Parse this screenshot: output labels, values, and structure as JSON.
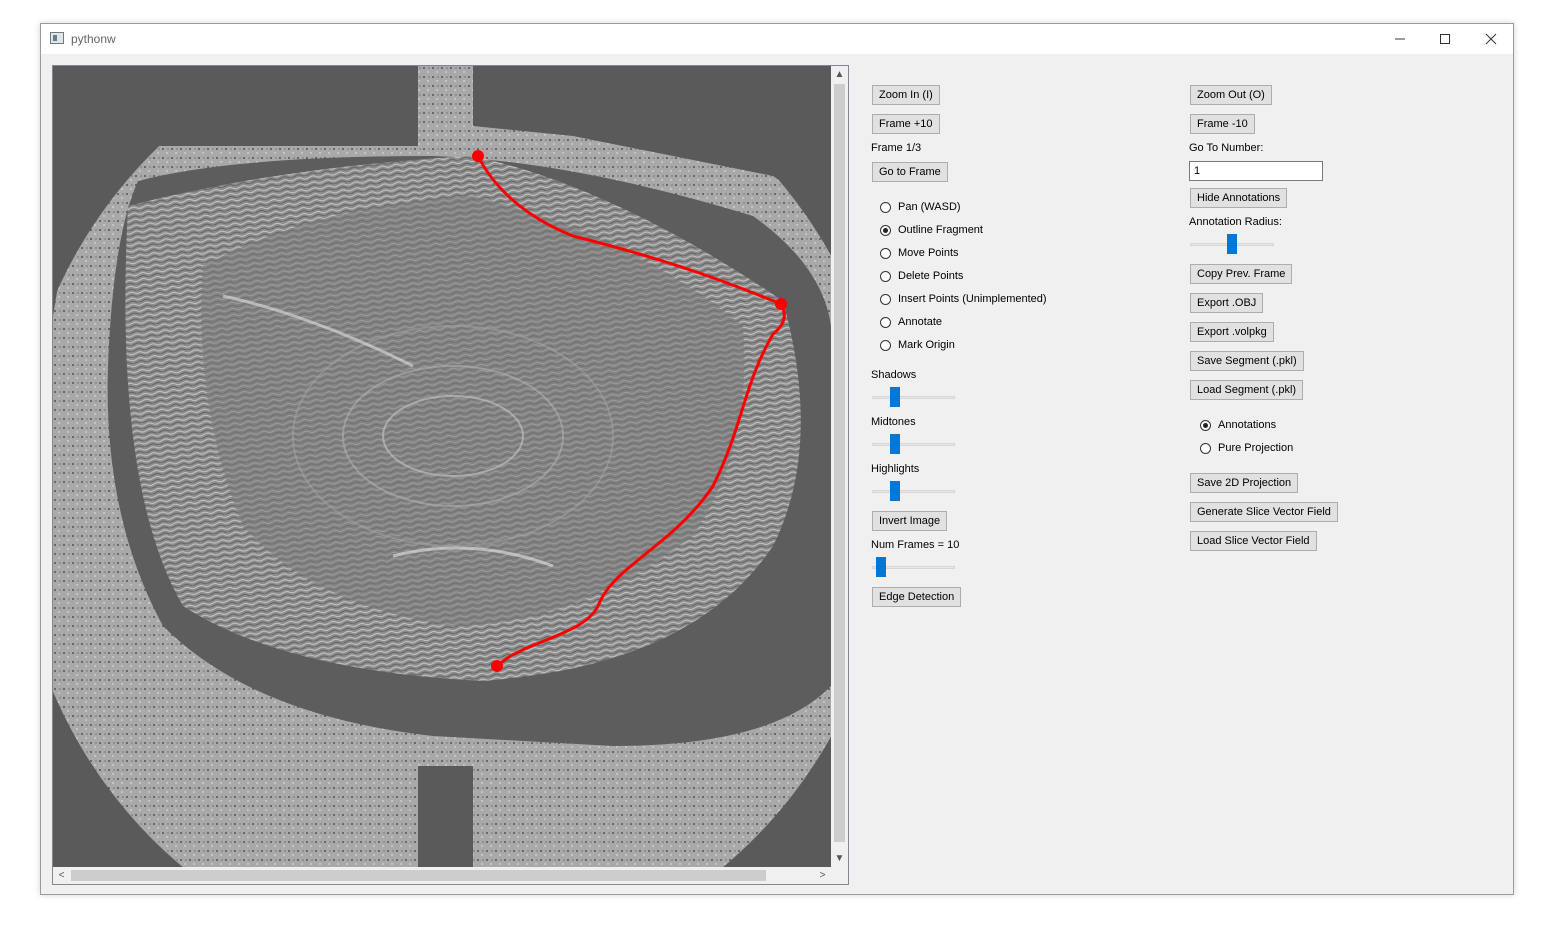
{
  "window": {
    "title": "pythonw"
  },
  "viewer": {
    "scroll_up": "▲",
    "scroll_down": "▼",
    "scroll_left": "<",
    "scroll_right": ">",
    "outline_color": "#ff0000"
  },
  "left_controls": {
    "zoom_in": "Zoom In (I)",
    "frame_plus": "Frame +10",
    "frame_label": "Frame 1/3",
    "go_to_frame": "Go to Frame",
    "modes": [
      {
        "label": "Pan (WASD)",
        "selected": false
      },
      {
        "label": "Outline Fragment",
        "selected": true
      },
      {
        "label": "Move Points",
        "selected": false
      },
      {
        "label": "Delete Points",
        "selected": false
      },
      {
        "label": "Insert Points (Unimplemented)",
        "selected": false
      },
      {
        "label": "Annotate",
        "selected": false
      },
      {
        "label": "Mark Origin",
        "selected": false
      }
    ],
    "shadows": "Shadows",
    "midtones": "Midtones",
    "highlights": "Highlights",
    "invert_image": "Invert Image",
    "num_frames": "Num Frames = 10",
    "edge_detection": "Edge Detection"
  },
  "right_controls": {
    "zoom_out": "Zoom Out (O)",
    "frame_minus": "Frame -10",
    "go_to_number": "Go To Number:",
    "go_to_value": "1",
    "hide_annotations": "Hide Annotations",
    "annotation_radius": "Annotation Radius:",
    "copy_prev_frame": "Copy Prev. Frame",
    "export_obj": "Export .OBJ",
    "export_volpkg": "Export .volpkg",
    "save_segment": "Save Segment (.pkl)",
    "load_segment": "Load Segment (.pkl)",
    "view_modes": [
      {
        "label": "Annotations",
        "selected": true
      },
      {
        "label": "Pure Projection",
        "selected": false
      }
    ],
    "save_2d": "Save 2D Projection",
    "generate_field": "Generate Slice Vector Field",
    "load_field": "Load Slice Vector Field"
  }
}
